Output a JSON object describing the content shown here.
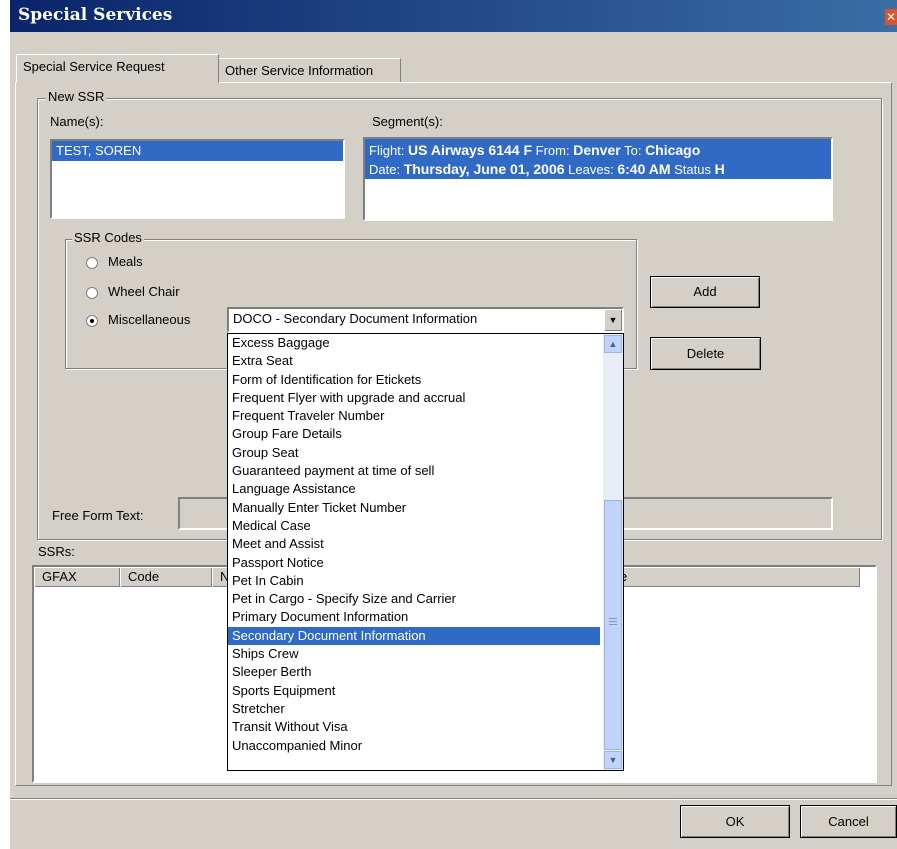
{
  "window": {
    "title": "Special Services"
  },
  "tabs": [
    "Special Service Request",
    "Other Service Information"
  ],
  "new_ssr": {
    "legend": "New SSR",
    "names_label": "Name(s):",
    "names": [
      "TEST, SOREN"
    ],
    "segments_label": "Segment(s):",
    "segment": {
      "flight_label": "Flight:",
      "flight": "US Airways 6144 F",
      "from_label": "From:",
      "from": "Denver",
      "to_label": "To:",
      "to": "Chicago",
      "date_label": "Date:",
      "date": "Thursday, June 01, 2006",
      "leaves_label": "Leaves:",
      "leaves": "6:40 AM",
      "status_label": "Status",
      "status": "H"
    }
  },
  "ssr_codes": {
    "legend": "SSR Codes",
    "options": [
      "Meals",
      "Wheel Chair",
      "Miscellaneous"
    ],
    "selected": "Miscellaneous",
    "misc_value": "DOCO - Secondary Document Information"
  },
  "buttons": {
    "add": "Add",
    "delete": "Delete",
    "ok": "OK",
    "cancel": "Cancel"
  },
  "free_form_label": "Free Form Text:",
  "ssrs_label": "SSRs:",
  "ssrs_columns": [
    "GFAX",
    "Code",
    "N",
    "e"
  ],
  "dropdown_items": [
    "Excess Baggage",
    "Extra Seat",
    "Form of Identification for Etickets",
    "Frequent Flyer with upgrade and accrual",
    "Frequent Traveler Number",
    "Group Fare Details",
    "Group Seat",
    "Guaranteed payment at time of sell",
    "Language Assistance",
    "Manually Enter Ticket Number",
    "Medical Case",
    "Meet and Assist",
    "Passport Notice",
    "Pet In Cabin",
    "Pet in Cargo - Specify Size and Carrier",
    "Primary Document Information",
    "Secondary Document Information",
    "Ships Crew",
    "Sleeper Berth",
    "Sports Equipment",
    "Stretcher",
    "Transit Without Visa",
    "Unaccompanied Minor"
  ],
  "dropdown_selected_index": 16,
  "colors": {
    "titlebar": "#0a246a",
    "selection": "#316ac5",
    "face": "#d4d0c8"
  }
}
